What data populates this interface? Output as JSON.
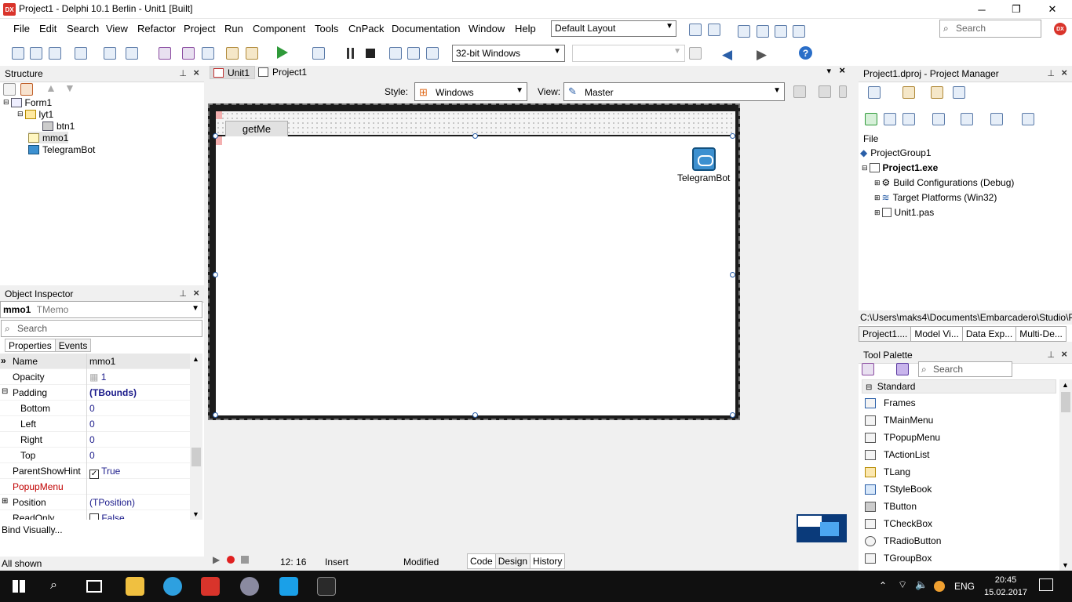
{
  "window": {
    "title": "Project1 - Delphi 10.1 Berlin - Unit1 [Built]",
    "controls": [
      "─",
      "❐",
      "✕"
    ]
  },
  "menu": {
    "items": [
      "File",
      "Edit",
      "Search",
      "View",
      "Refactor",
      "Project",
      "Run",
      "Component",
      "Tools",
      "CnPack",
      "Documentation",
      "Window",
      "Help"
    ],
    "layout": "Default Layout",
    "search_placeholder": "Search"
  },
  "toolbar": {
    "platform": "32-bit Windows"
  },
  "structure": {
    "title": "Structure",
    "nodes": [
      "Form1",
      "lyt1",
      "btn1",
      "mmo1",
      "TelegramBot"
    ]
  },
  "object_inspector": {
    "title": "Object Inspector",
    "selected_name": "mmo1",
    "selected_type": "TMemo",
    "search_placeholder": "Search",
    "tabs": [
      "Properties",
      "Events"
    ],
    "properties": [
      {
        "name": "Name",
        "value": "mmo1"
      },
      {
        "name": "Opacity",
        "value": "1"
      },
      {
        "name": "Padding",
        "value": "(TBounds)"
      },
      {
        "name": "Bottom",
        "value": "0"
      },
      {
        "name": "Left",
        "value": "0"
      },
      {
        "name": "Right",
        "value": "0"
      },
      {
        "name": "Top",
        "value": "0"
      },
      {
        "name": "ParentShowHint",
        "value": "True"
      },
      {
        "name": "PopupMenu",
        "value": ""
      },
      {
        "name": "Position",
        "value": "(TPosition)"
      },
      {
        "name": "ReadOnly",
        "value": "False"
      }
    ],
    "bind_visually": "Bind Visually...",
    "all_shown": "All shown"
  },
  "editor": {
    "tabs": [
      "Unit1",
      "Project1"
    ],
    "style_label": "Style:",
    "style_value": "Windows",
    "view_label": "View:",
    "view_value": "Master",
    "button_caption": "getMe",
    "component_label": "TelegramBot"
  },
  "status": {
    "position": "12:  16",
    "mode": "Insert",
    "state": "Modified",
    "tabs": [
      "Code",
      "Design",
      "History"
    ]
  },
  "project_manager": {
    "title": "Project1.dproj - Project Manager",
    "file_label": "File",
    "nodes": [
      "ProjectGroup1",
      "Project1.exe",
      "Build Configurations (Debug)",
      "Target Platforms (Win32)",
      "Unit1.pas"
    ],
    "path": "C:\\Users\\maks4\\Documents\\Embarcadero\\Studio\\P",
    "tabs": [
      "Project1....",
      "Model Vi...",
      "Data Exp...",
      "Multi-De..."
    ]
  },
  "tool_palette": {
    "title": "Tool Palette",
    "search_placeholder": "Search",
    "category": "Standard",
    "items": [
      "Frames",
      "TMainMenu",
      "TPopupMenu",
      "TActionList",
      "TLang",
      "TStyleBook",
      "TButton",
      "TCheckBox",
      "TRadioButton",
      "TGroupBox"
    ]
  },
  "taskbar": {
    "language": "ENG",
    "time": "20:45",
    "date": "15.02.2017"
  },
  "colors": {
    "accent_blue": "#2a5fa8",
    "delphi_red": "#d9342b",
    "popup_menu_label": "#c00000",
    "bool_value": "#1a1a8a"
  }
}
